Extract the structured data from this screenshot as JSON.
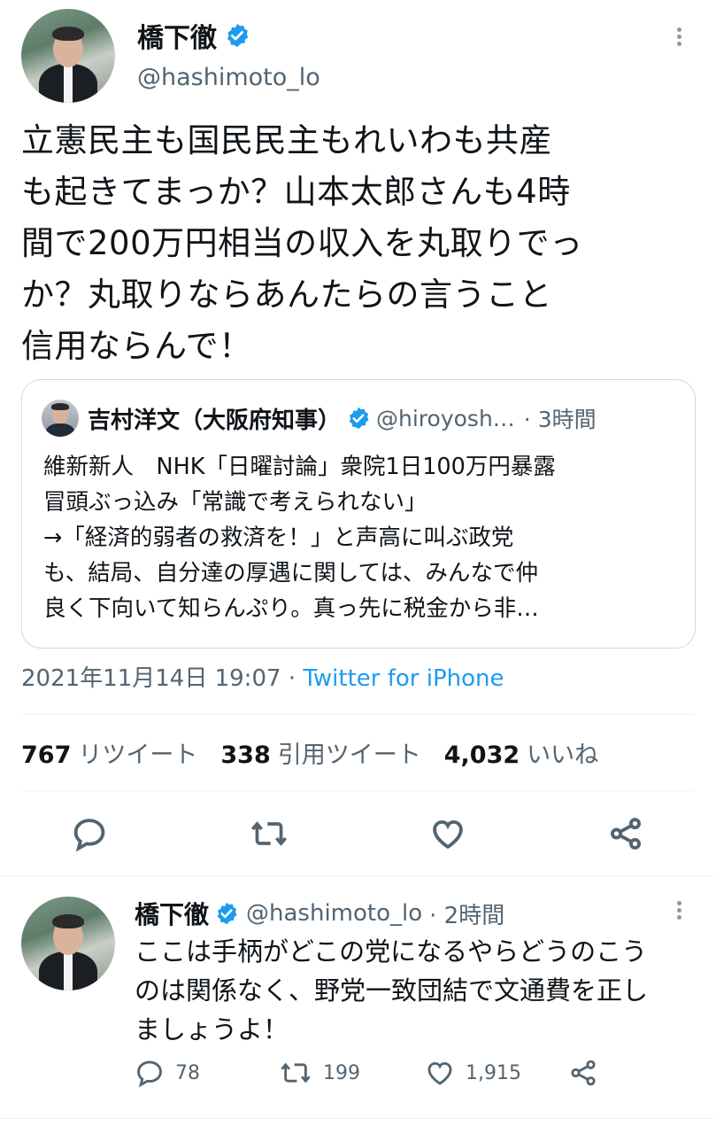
{
  "main_tweet": {
    "name": "橋下徹",
    "handle": "@hashimoto_lo",
    "text": "立憲民主も国民民主もれいわも共産も起きてまっか？山本太郎さんも4時間で200万円相当の収入を丸取りでっか？丸取りならあんたらの言うこと信用ならんで！",
    "text_lines": [
      "立憲民主も国民民主もれいわも共産",
      "も起きてまっか？山本太郎さんも4時",
      "間で200万円相当の収入を丸取りでっ",
      "か？丸取りならあんたらの言うこと",
      "信用ならんで！"
    ],
    "timestamp": "2021年11月14日 19:07 · ",
    "source": "Twitter for iPhone",
    "retweets": "767",
    "retweets_label": "リツイート",
    "quotes": "338",
    "quotes_label": "引用ツイート",
    "likes": "4,032",
    "likes_label": "いいね"
  },
  "quoted_tweet": {
    "name": "吉村洋文（大阪府知事）",
    "handle": "@hiroyosh…",
    "time": "· 3時間",
    "lines": [
      "維新新人　NHK「日曜討論」衆院1日100万円暴露",
      "冒頭ぶっ込み「常識で考えられない」",
      "→「経済的弱者の救済を！」と声高に叫ぶ政党",
      "も、結局、自分達の厚遇に関しては、みんなで仲",
      "良く下向いて知らんぷり。真っ先に税金から非…"
    ]
  },
  "reply": {
    "name": "橋下徹",
    "handle": "@hashimoto_lo",
    "time": "· 2時間",
    "lines": [
      "ここは手柄がどこの党になるやらどうのこう",
      "のは関係なく、野党一致団結で文通費を正し",
      "ましょうよ！"
    ],
    "reply_count": "78",
    "retweet_count": "199",
    "like_count": "1,915"
  },
  "icons": {
    "verified": "verified-badge-icon",
    "reply": "reply-icon",
    "retweet": "retweet-icon",
    "like": "heart-icon",
    "share": "share-icon",
    "more": "more-dots-icon"
  },
  "colors": {
    "accent": "#1d9bf0",
    "text": "#0f1419",
    "secondary": "#536471",
    "border": "#cfd9de"
  }
}
